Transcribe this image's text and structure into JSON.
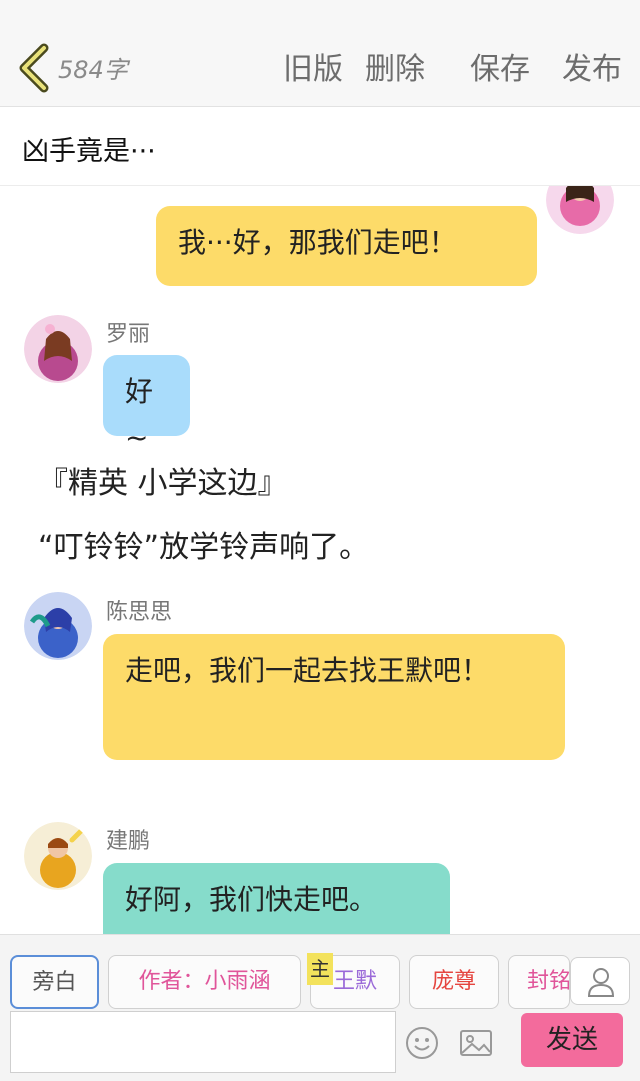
{
  "header": {
    "word_count": "584字",
    "actions": [
      "旧版",
      "删除",
      "保存",
      "发布"
    ]
  },
  "story": {
    "title": "凶手竟是···"
  },
  "messages": [
    {
      "speaker": "",
      "text": "我···好，那我们走吧！"
    },
    {
      "speaker": "罗丽",
      "text": "好~"
    },
    {
      "narration": "『精英 小学这边』"
    },
    {
      "narration": "“叮铃铃”放学铃声响了。"
    },
    {
      "speaker": "陈思思",
      "text": "走吧，我们一起去找王默吧！"
    },
    {
      "speaker": "建鹏",
      "text": "好阿，我们快走吧。"
    }
  ],
  "characters": [
    "旁白",
    "作者：小雨涵",
    "王默",
    "庞尊",
    "封铭"
  ],
  "main_badge": "主",
  "send_label": "发送",
  "colors": {
    "yellow_bubble": "#fddb69",
    "blue_bubble": "#a9dcfb",
    "teal_bubble": "#86dccb",
    "send_button": "#f36b9c"
  }
}
